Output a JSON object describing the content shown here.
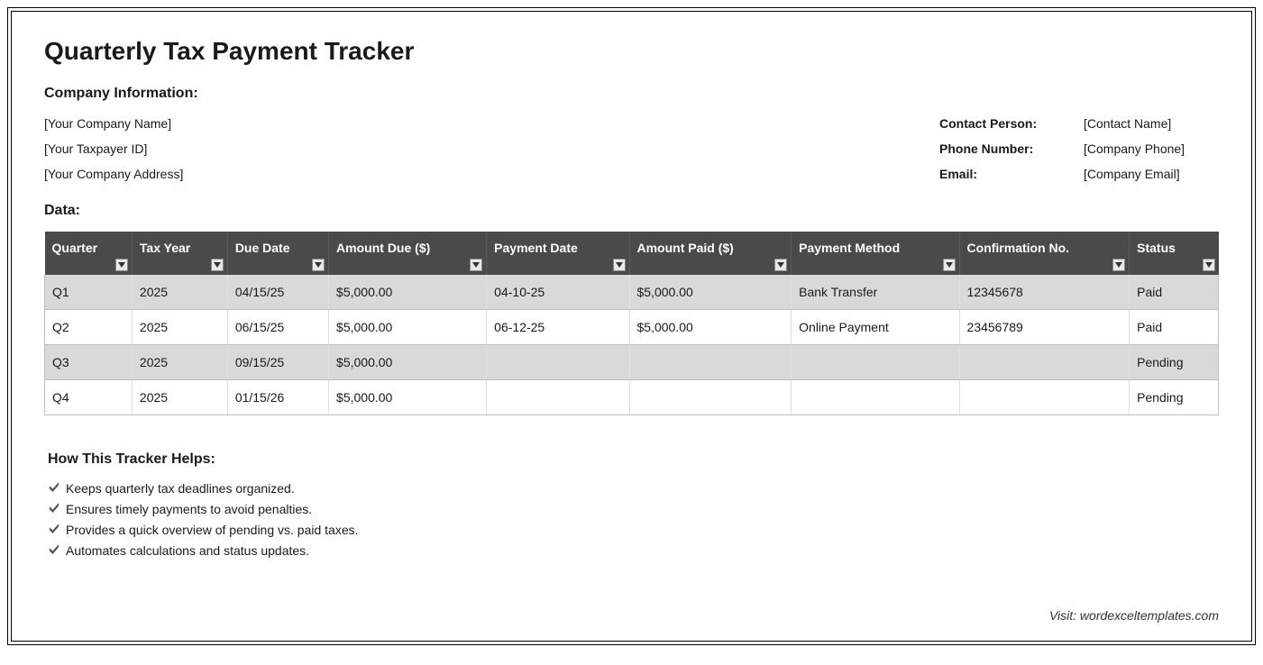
{
  "title": "Quarterly Tax Payment Tracker",
  "company_info_label": "Company Information:",
  "company": {
    "name": "[Your Company Name]",
    "taxpayer_id": "[Your Taxpayer ID]",
    "address": "[Your Company Address]"
  },
  "contact": {
    "person_label": "Contact Person:",
    "person_value": "[Contact Name]",
    "phone_label": "Phone Number:",
    "phone_value": "[Company Phone]",
    "email_label": "Email:",
    "email_value": "[Company Email]"
  },
  "data_label": "Data:",
  "headers": {
    "quarter": "Quarter",
    "tax_year": "Tax Year",
    "due_date": "Due Date",
    "amount_due": "Amount Due ($)",
    "payment_date": "Payment Date",
    "amount_paid": "Amount Paid ($)",
    "payment_method": "Payment Method",
    "confirmation_no": "Confirmation No.",
    "status": "Status"
  },
  "rows": [
    {
      "quarter": "Q1",
      "tax_year": "2025",
      "due_date": "04/15/25",
      "amount_due": "$5,000.00",
      "payment_date": "04-10-25",
      "amount_paid": "$5,000.00",
      "payment_method": "Bank Transfer",
      "confirmation_no": "12345678",
      "status": "Paid"
    },
    {
      "quarter": "Q2",
      "tax_year": "2025",
      "due_date": "06/15/25",
      "amount_due": "$5,000.00",
      "payment_date": "06-12-25",
      "amount_paid": "$5,000.00",
      "payment_method": "Online Payment",
      "confirmation_no": "23456789",
      "status": "Paid"
    },
    {
      "quarter": "Q3",
      "tax_year": "2025",
      "due_date": "09/15/25",
      "amount_due": "$5,000.00",
      "payment_date": "",
      "amount_paid": "",
      "payment_method": "",
      "confirmation_no": "",
      "status": "Pending"
    },
    {
      "quarter": "Q4",
      "tax_year": "2025",
      "due_date": "01/15/26",
      "amount_due": "$5,000.00",
      "payment_date": "",
      "amount_paid": "",
      "payment_method": "",
      "confirmation_no": "",
      "status": "Pending"
    }
  ],
  "helps_title": "How This Tracker Helps:",
  "helps": [
    "Keeps quarterly tax deadlines organized.",
    "Ensures timely payments to avoid penalties.",
    "Provides a quick overview of pending vs. paid taxes.",
    "Automates calculations and status updates."
  ],
  "visit": "Visit: wordexceltemplates.com"
}
